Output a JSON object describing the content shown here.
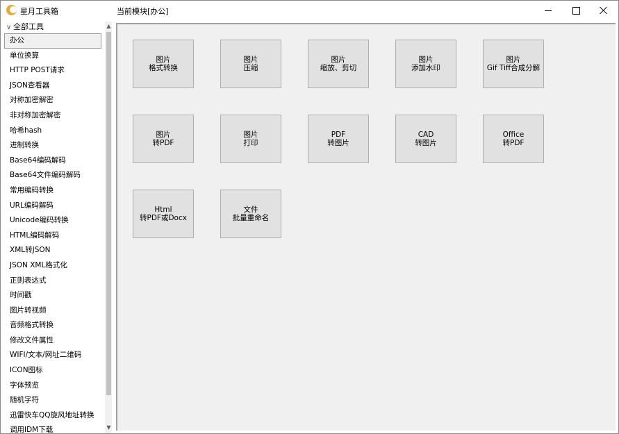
{
  "app": {
    "title": "星月工具箱",
    "module_title": "当前模块[办公]"
  },
  "sidebar": {
    "root_label": "全部工具",
    "items": [
      "办公",
      "单位换算",
      "HTTP POST请求",
      "JSON查看器",
      "对称加密解密",
      "非对称加密解密",
      "哈希hash",
      "进制转换",
      "Base64编码解码",
      "Base64文件编码解码",
      "常用编码转换",
      "URL编码解码",
      "Unicode编码转换",
      "HTML编码解码",
      "XML转JSON",
      "JSON XML格式化",
      "正则表达式",
      "时间戳",
      "图片转视频",
      "音频格式转换",
      "修改文件属性",
      "WIFI/文本/网址二维码",
      "ICON图标",
      "字体预览",
      "随机字符",
      "迅雷快车QQ旋风地址转换",
      "调用IDM下载"
    ]
  },
  "tools": [
    {
      "line1": "图片",
      "line2": "格式转换"
    },
    {
      "line1": "图片",
      "line2": "压缩"
    },
    {
      "line1": "图片",
      "line2": "缩放、剪切"
    },
    {
      "line1": "图片",
      "line2": "添加水印"
    },
    {
      "line1": "图片",
      "line2": "Gif Tiff合成分解"
    },
    {
      "line1": "图片",
      "line2": "转PDF"
    },
    {
      "line1": "图片",
      "line2": "打印"
    },
    {
      "line1": "PDF",
      "line2": "转图片"
    },
    {
      "line1": "CAD",
      "line2": "转图片"
    },
    {
      "line1": "Office",
      "line2": "转PDF"
    },
    {
      "line1": "Html",
      "line2": "转PDF或Docx"
    },
    {
      "line1": "文件",
      "line2": "批量重命名"
    }
  ]
}
